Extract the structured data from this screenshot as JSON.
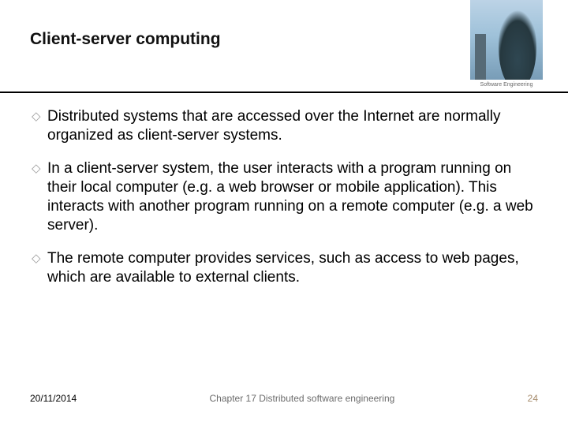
{
  "title": "Client-server computing",
  "thumb": {
    "label": "Software Engineering"
  },
  "bullets": [
    "Distributed systems that are accessed over the Internet are normally organized as client-server systems.",
    "In a client-server system, the user interacts with a program running on their local computer (e.g. a web browser or mobile application). This interacts with another program running on a remote computer (e.g. a web server).",
    "The remote computer provides services, such as access to web pages, which are available to external clients."
  ],
  "footer": {
    "date": "20/11/2014",
    "chapter": "Chapter 17 Distributed software engineering",
    "page": "24"
  }
}
